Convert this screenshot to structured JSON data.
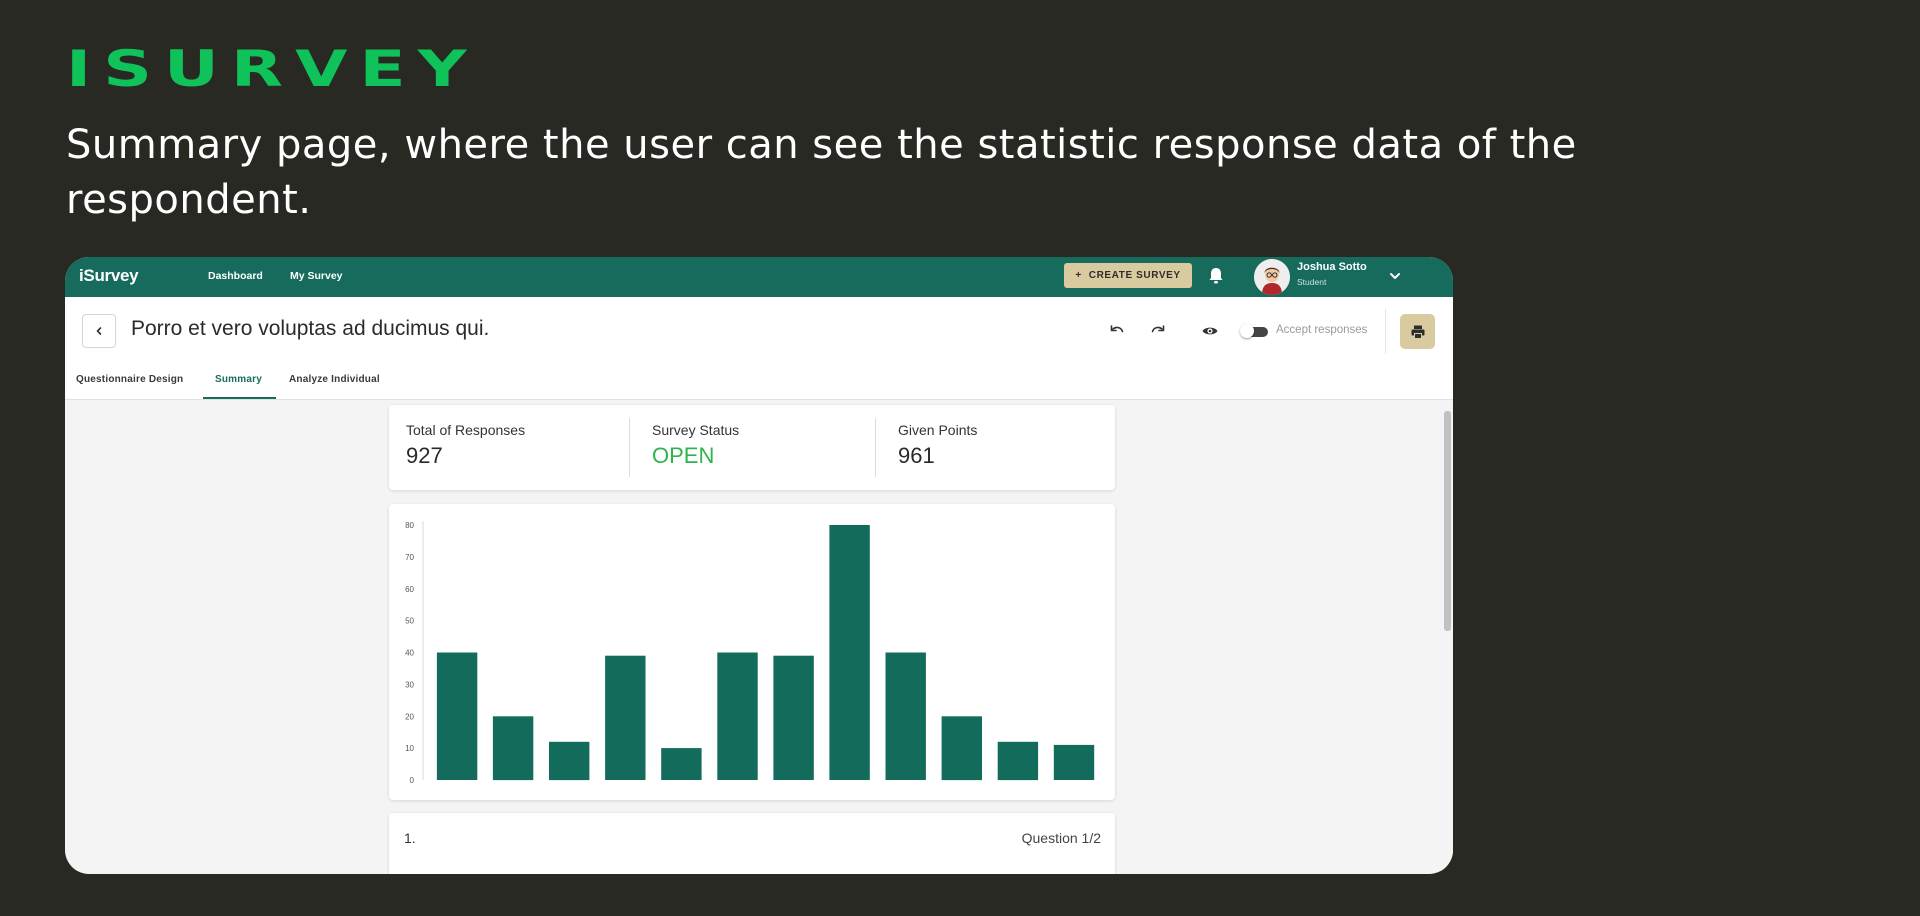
{
  "brand": {
    "logo_text": "ISURVEY",
    "color": "#10c25a"
  },
  "caption": "Summary page, where the user can see the statistic response data of the respondent.",
  "app": {
    "topbar": {
      "logo": "iSurvey",
      "nav": [
        "Dashboard",
        "My Survey"
      ],
      "create_button": "CREATE SURVEY",
      "create_icon": "+",
      "user_name": "Joshua Sotto",
      "user_role": "Student",
      "accent": "#166b5c"
    },
    "header": {
      "survey_title": "Porro et vero voluptas ad ducimus qui.",
      "toggle_label": "Accept responses",
      "toggle_on": false,
      "tabs": [
        "Questionnaire Design",
        "Summary",
        "Analyze Individual"
      ],
      "active_tab": "Summary"
    },
    "stats": [
      {
        "label": "Total of Responses",
        "value": "927"
      },
      {
        "label": "Survey Status",
        "value": "OPEN"
      },
      {
        "label": "Given Points",
        "value": "961"
      }
    ],
    "question": {
      "number": "1.",
      "counter": "Question 1/2"
    }
  },
  "chart_data": {
    "type": "bar",
    "title": "",
    "xlabel": "",
    "ylabel": "",
    "categories": [],
    "values": [
      40,
      20,
      12,
      39,
      10,
      40,
      39,
      80,
      40,
      20,
      12,
      11
    ],
    "ylim": [
      0,
      80
    ],
    "yticks": [
      0,
      10,
      20,
      30,
      40,
      50,
      60,
      70,
      80
    ],
    "bar_color": "#136b5b",
    "grid": false
  }
}
